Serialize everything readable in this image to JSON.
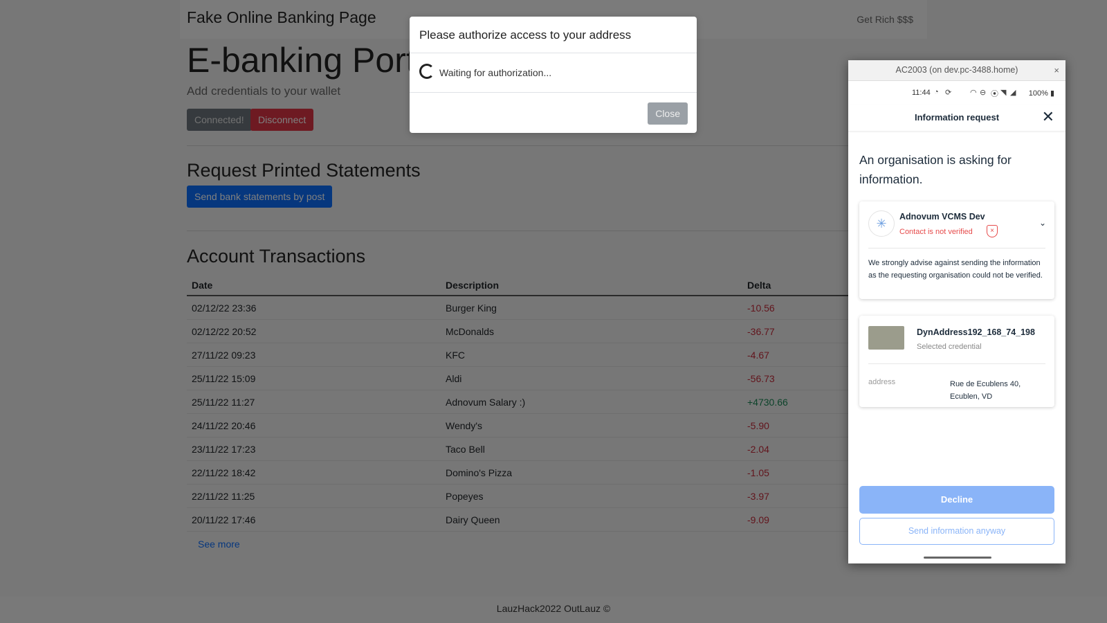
{
  "navbar": {
    "brand": "Fake Online Banking Page",
    "right_link": "Get Rich $$$"
  },
  "portal": {
    "title": "E-banking Portal",
    "subtitle": "Add credentials to your wallet",
    "connected_label": "Connected!",
    "disconnect_label": "Disconnect"
  },
  "statements": {
    "title": "Request Printed Statements",
    "send_label": "Send bank statements by post"
  },
  "transactions": {
    "title": "Account Transactions",
    "columns": [
      "Date",
      "Description",
      "Delta"
    ],
    "rows": [
      {
        "date": "02/12/22 23:36",
        "description": "Burger King",
        "delta": "-10.56"
      },
      {
        "date": "02/12/22 20:52",
        "description": "McDonalds",
        "delta": "-36.77"
      },
      {
        "date": "27/11/22 09:23",
        "description": "KFC",
        "delta": "-4.67"
      },
      {
        "date": "25/11/22 15:09",
        "description": "Aldi",
        "delta": "-56.73"
      },
      {
        "date": "25/11/22 11:27",
        "description": "Adnovum Salary :)",
        "delta": "+4730.66"
      },
      {
        "date": "24/11/22 20:46",
        "description": "Wendy's",
        "delta": "-5.90"
      },
      {
        "date": "23/11/22 17:23",
        "description": "Taco Bell",
        "delta": "-2.04"
      },
      {
        "date": "22/11/22 18:42",
        "description": "Domino's Pizza",
        "delta": "-1.05"
      },
      {
        "date": "22/11/22 11:25",
        "description": "Popeyes",
        "delta": "-3.97"
      },
      {
        "date": "20/11/22 17:46",
        "description": "Dairy Queen",
        "delta": "-9.09"
      }
    ],
    "see_more": "See more"
  },
  "footer": "LauzHack2022 OutLauz ©",
  "modal": {
    "title": "Please authorize access to your address",
    "status": "Waiting for authorization...",
    "close_label": "Close"
  },
  "phone": {
    "window_title": "AC2003 (on dev.pc-3488.home)",
    "window_close": "×",
    "time": "11:44",
    "battery": "100%",
    "header": "Information request",
    "ask": "An organisation is asking for information.",
    "org": {
      "name": "Adnovum VCMS Dev",
      "warning": "Contact is not verified",
      "advice": "We strongly advise against sending the information as the requesting organisation could not be verified."
    },
    "credential": {
      "name": "DynAddress192_168_74_198",
      "subtitle": "Selected credential",
      "field_key": "address",
      "field_value": "Rue de Ecublens 40, Ecublen, VD"
    },
    "decline_label": "Decline",
    "send_anyway_label": "Send information anyway"
  },
  "colors": {
    "danger": "#dc3545",
    "primary": "#0d6efd",
    "positive": "#198754",
    "decline_button": "#8ab4f8"
  }
}
